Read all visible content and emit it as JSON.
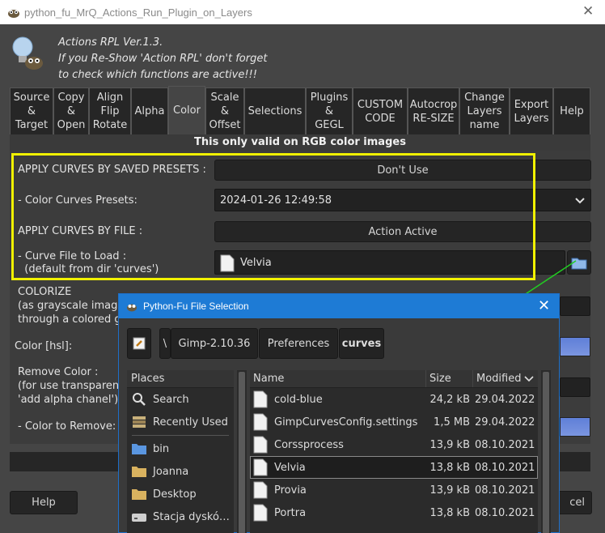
{
  "window": {
    "title": "python_fu_MrQ_Actions_Run_Plugin_on_Layers",
    "close": "✕"
  },
  "header": {
    "line1": "Actions RPL Ver.1.3.",
    "line2": "If you Re-Show 'Action RPL' don't forget",
    "line3": "to check which functions are active!!!"
  },
  "tabs": [
    {
      "label": "Source\n&\nTarget"
    },
    {
      "label": "Copy\n&\nOpen"
    },
    {
      "label": "Align\nFlip\nRotate"
    },
    {
      "label": "Alpha"
    },
    {
      "label": "Color",
      "active": true
    },
    {
      "label": "Scale\n&\nOffset"
    },
    {
      "label": "Selections"
    },
    {
      "label": "Plugins\n&\nGEGL"
    },
    {
      "label": "CUSTOM\nCODE"
    },
    {
      "label": "Autocrop\nRE-SIZE"
    },
    {
      "label": "Change\nLayers\nname"
    },
    {
      "label": "Export\nLayers"
    },
    {
      "label": "Help"
    }
  ],
  "notice": "This only valid on RGB color images",
  "form": {
    "presets_label": "APPLY CURVES BY SAVED PRESETS :",
    "presets_value": "Don't Use",
    "color_curves_label": "- Color Curves Presets:",
    "color_curves_value": "2024-01-26 12:49:58",
    "by_file_label": "APPLY CURVES BY FILE :",
    "by_file_value": "Action Active",
    "curve_file_label1": "- Curve File to Load :",
    "curve_file_label2": "  (default from dir 'curves')",
    "curve_file_value": "Velvia",
    "colorize_label1": "COLORIZE",
    "colorize_label2": "(as grayscale imag",
    "colorize_label3": "through a colored g",
    "color_hsl_label": "Color [hsl]:",
    "remove_color_label1": "Remove Color :",
    "remove_color_label2": "(for use transparen",
    "remove_color_label3": "'add alpha chanel')",
    "color_to_remove_label": "- Color to Remove:"
  },
  "buttons": {
    "help": "Help",
    "cancel": "cel"
  },
  "dialog": {
    "title": "Python-Fu File Selection",
    "close": "✕",
    "path_sep": "\\",
    "path": [
      "Gimp-2.10.36",
      "Preferences",
      "curves"
    ],
    "places_header": "Places",
    "places": [
      {
        "label": "Search",
        "icon": "search-icon"
      },
      {
        "label": "Recently Used",
        "icon": "recent-icon"
      },
      {
        "label": "bin",
        "icon": "folder-icon"
      },
      {
        "label": "Joanna",
        "icon": "folder-icon"
      },
      {
        "label": "Desktop",
        "icon": "folder-icon"
      },
      {
        "label": "Stacja dyskó…",
        "icon": "drive-icon"
      }
    ],
    "columns": {
      "name": "Name",
      "size": "Size",
      "modified": "Modified"
    },
    "files": [
      {
        "name": "cold-blue",
        "size": "24,2 kB",
        "modified": "29.04.2022"
      },
      {
        "name": "GimpCurvesConfig.settings",
        "size": "1,5 MB",
        "modified": "29.04.2022"
      },
      {
        "name": "Corssprocess",
        "size": "13,9 kB",
        "modified": "08.10.2021"
      },
      {
        "name": "Velvia",
        "size": "13,8 kB",
        "modified": "08.10.2021",
        "selected": true
      },
      {
        "name": "Provia",
        "size": "13,9 kB",
        "modified": "08.10.2021"
      },
      {
        "name": "Portra",
        "size": "13,8 kB",
        "modified": "08.10.2021"
      }
    ]
  },
  "colors": {
    "highlight_box": "#f1f100",
    "dialog_titlebar": "#1e7bd5",
    "arrow": "#22cc22",
    "swatch": "#6a88dc"
  }
}
